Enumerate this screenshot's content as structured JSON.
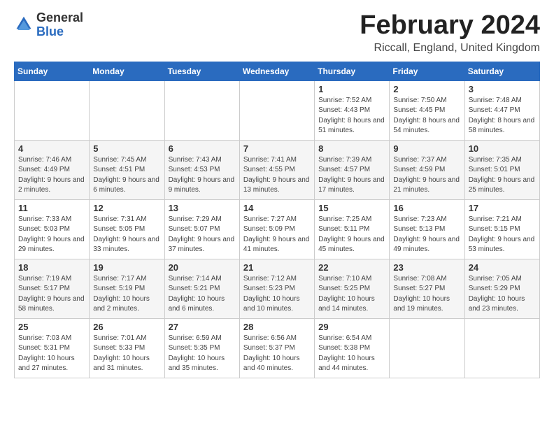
{
  "logo": {
    "general": "General",
    "blue": "Blue"
  },
  "title": "February 2024",
  "subtitle": "Riccall, England, United Kingdom",
  "days_of_week": [
    "Sunday",
    "Monday",
    "Tuesday",
    "Wednesday",
    "Thursday",
    "Friday",
    "Saturday"
  ],
  "weeks": [
    [
      {
        "day": "",
        "info": ""
      },
      {
        "day": "",
        "info": ""
      },
      {
        "day": "",
        "info": ""
      },
      {
        "day": "",
        "info": ""
      },
      {
        "day": "1",
        "info": "Sunrise: 7:52 AM\nSunset: 4:43 PM\nDaylight: 8 hours and 51 minutes."
      },
      {
        "day": "2",
        "info": "Sunrise: 7:50 AM\nSunset: 4:45 PM\nDaylight: 8 hours and 54 minutes."
      },
      {
        "day": "3",
        "info": "Sunrise: 7:48 AM\nSunset: 4:47 PM\nDaylight: 8 hours and 58 minutes."
      }
    ],
    [
      {
        "day": "4",
        "info": "Sunrise: 7:46 AM\nSunset: 4:49 PM\nDaylight: 9 hours and 2 minutes."
      },
      {
        "day": "5",
        "info": "Sunrise: 7:45 AM\nSunset: 4:51 PM\nDaylight: 9 hours and 6 minutes."
      },
      {
        "day": "6",
        "info": "Sunrise: 7:43 AM\nSunset: 4:53 PM\nDaylight: 9 hours and 9 minutes."
      },
      {
        "day": "7",
        "info": "Sunrise: 7:41 AM\nSunset: 4:55 PM\nDaylight: 9 hours and 13 minutes."
      },
      {
        "day": "8",
        "info": "Sunrise: 7:39 AM\nSunset: 4:57 PM\nDaylight: 9 hours and 17 minutes."
      },
      {
        "day": "9",
        "info": "Sunrise: 7:37 AM\nSunset: 4:59 PM\nDaylight: 9 hours and 21 minutes."
      },
      {
        "day": "10",
        "info": "Sunrise: 7:35 AM\nSunset: 5:01 PM\nDaylight: 9 hours and 25 minutes."
      }
    ],
    [
      {
        "day": "11",
        "info": "Sunrise: 7:33 AM\nSunset: 5:03 PM\nDaylight: 9 hours and 29 minutes."
      },
      {
        "day": "12",
        "info": "Sunrise: 7:31 AM\nSunset: 5:05 PM\nDaylight: 9 hours and 33 minutes."
      },
      {
        "day": "13",
        "info": "Sunrise: 7:29 AM\nSunset: 5:07 PM\nDaylight: 9 hours and 37 minutes."
      },
      {
        "day": "14",
        "info": "Sunrise: 7:27 AM\nSunset: 5:09 PM\nDaylight: 9 hours and 41 minutes."
      },
      {
        "day": "15",
        "info": "Sunrise: 7:25 AM\nSunset: 5:11 PM\nDaylight: 9 hours and 45 minutes."
      },
      {
        "day": "16",
        "info": "Sunrise: 7:23 AM\nSunset: 5:13 PM\nDaylight: 9 hours and 49 minutes."
      },
      {
        "day": "17",
        "info": "Sunrise: 7:21 AM\nSunset: 5:15 PM\nDaylight: 9 hours and 53 minutes."
      }
    ],
    [
      {
        "day": "18",
        "info": "Sunrise: 7:19 AM\nSunset: 5:17 PM\nDaylight: 9 hours and 58 minutes."
      },
      {
        "day": "19",
        "info": "Sunrise: 7:17 AM\nSunset: 5:19 PM\nDaylight: 10 hours and 2 minutes."
      },
      {
        "day": "20",
        "info": "Sunrise: 7:14 AM\nSunset: 5:21 PM\nDaylight: 10 hours and 6 minutes."
      },
      {
        "day": "21",
        "info": "Sunrise: 7:12 AM\nSunset: 5:23 PM\nDaylight: 10 hours and 10 minutes."
      },
      {
        "day": "22",
        "info": "Sunrise: 7:10 AM\nSunset: 5:25 PM\nDaylight: 10 hours and 14 minutes."
      },
      {
        "day": "23",
        "info": "Sunrise: 7:08 AM\nSunset: 5:27 PM\nDaylight: 10 hours and 19 minutes."
      },
      {
        "day": "24",
        "info": "Sunrise: 7:05 AM\nSunset: 5:29 PM\nDaylight: 10 hours and 23 minutes."
      }
    ],
    [
      {
        "day": "25",
        "info": "Sunrise: 7:03 AM\nSunset: 5:31 PM\nDaylight: 10 hours and 27 minutes."
      },
      {
        "day": "26",
        "info": "Sunrise: 7:01 AM\nSunset: 5:33 PM\nDaylight: 10 hours and 31 minutes."
      },
      {
        "day": "27",
        "info": "Sunrise: 6:59 AM\nSunset: 5:35 PM\nDaylight: 10 hours and 35 minutes."
      },
      {
        "day": "28",
        "info": "Sunrise: 6:56 AM\nSunset: 5:37 PM\nDaylight: 10 hours and 40 minutes."
      },
      {
        "day": "29",
        "info": "Sunrise: 6:54 AM\nSunset: 5:38 PM\nDaylight: 10 hours and 44 minutes."
      },
      {
        "day": "",
        "info": ""
      },
      {
        "day": "",
        "info": ""
      }
    ]
  ]
}
